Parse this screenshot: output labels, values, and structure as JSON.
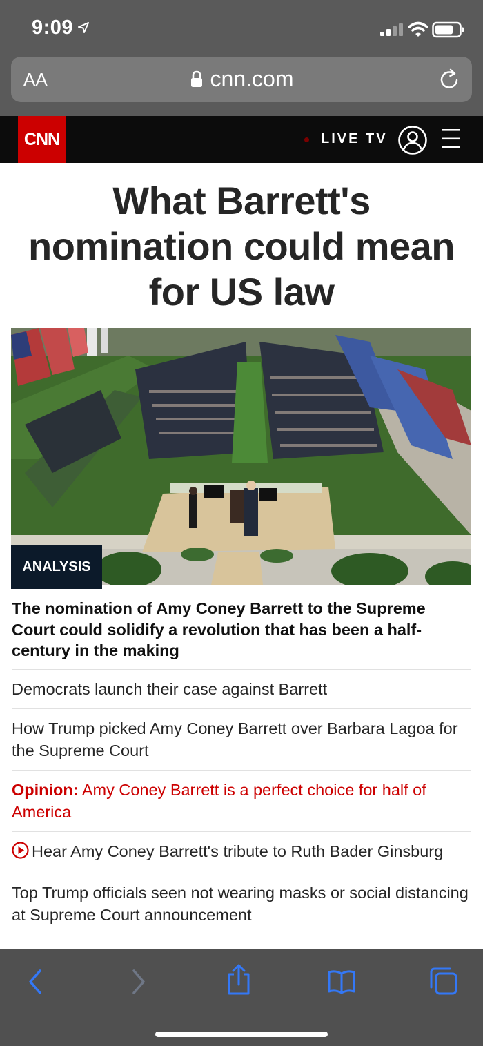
{
  "status_bar": {
    "time": "9:09"
  },
  "browser": {
    "text_size_label": "AA",
    "url": "cnn.com"
  },
  "cnn_header": {
    "logo": "CNN",
    "live_tv": "LIVE TV"
  },
  "article": {
    "headline": "What Barrett's nomination could mean for US law",
    "badge": "ANALYSIS",
    "summary": "The nomination of Amy Coney Barrett to the Supreme Court could solidify a revolution that has been a half-century in the making",
    "related_links": [
      {
        "text": "Democrats launch their case against Barrett"
      },
      {
        "text": "How Trump picked Amy Coney Barrett over Barbara Lagoa for the Supreme Court"
      },
      {
        "label": "Opinion:",
        "text": "Amy Coney Barrett is a perfect choice for half of America"
      },
      {
        "text": "Hear Amy Coney Barrett's tribute to Ruth Bader Ginsburg"
      },
      {
        "text": "Top Trump officials seen not wearing masks or social distancing at Supreme Court announcement"
      }
    ]
  },
  "colors": {
    "cnn_red": "#cc0000",
    "ios_blue": "#3478f6",
    "chrome_gray": "#5a5a5a"
  },
  "icons": {
    "status": [
      "location-arrow-icon",
      "signal-icon",
      "wifi-icon",
      "battery-icon"
    ],
    "browser": [
      "lock-icon",
      "reload-icon"
    ],
    "header": [
      "user-account-icon",
      "hamburger-menu-icon"
    ],
    "toolbar": [
      "back-icon",
      "forward-icon",
      "share-icon",
      "bookmarks-icon",
      "tabs-icon"
    ]
  }
}
